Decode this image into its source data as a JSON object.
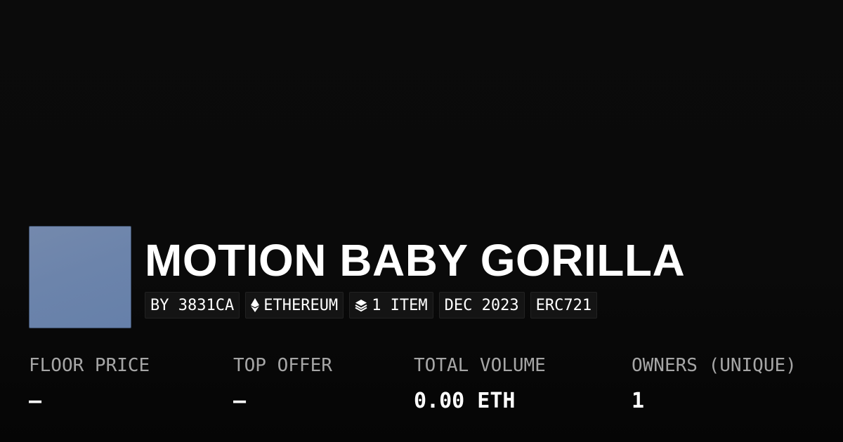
{
  "collection": {
    "title": "MOTION BABY GORILLA",
    "thumbnail_color": "#6f86ac"
  },
  "tags": [
    {
      "label": "BY 3831CA",
      "icon": ""
    },
    {
      "label": "ETHEREUM",
      "icon": "ethereum-icon"
    },
    {
      "label": "1 ITEM",
      "icon": "layers-icon"
    },
    {
      "label": "DEC 2023",
      "icon": ""
    },
    {
      "label": "ERC721",
      "icon": ""
    }
  ],
  "stats": [
    {
      "label": "FLOOR PRICE",
      "value": "—"
    },
    {
      "label": "TOP OFFER",
      "value": "—"
    },
    {
      "label": "TOTAL VOLUME",
      "value": "0.00 ETH"
    },
    {
      "label": "OWNERS (UNIQUE)",
      "value": "1"
    }
  ],
  "colors": {
    "background": "#0b0b0b",
    "label": "#a6a6a6",
    "text": "#ffffff",
    "tag_background": "#141414"
  }
}
